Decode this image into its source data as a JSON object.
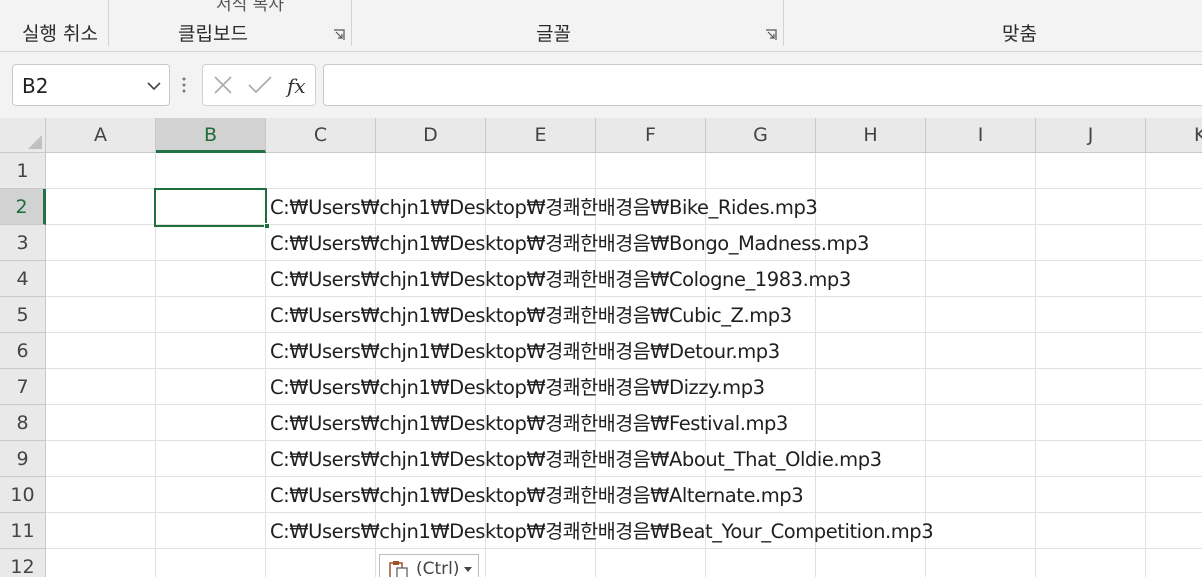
{
  "ribbon": {
    "groups": {
      "undo": "실행 취소",
      "clipboard": "클립보드",
      "font": "글꼴",
      "align": "맞춤"
    },
    "cut_off_label": "서식 복사"
  },
  "formula_bar": {
    "name_box": "B2",
    "formula_value": ""
  },
  "grid": {
    "column_headers": [
      "A",
      "B",
      "C",
      "D",
      "E",
      "F",
      "G",
      "H",
      "I",
      "J",
      "K"
    ],
    "row_headers": [
      "1",
      "2",
      "3",
      "4",
      "5",
      "6",
      "7",
      "8",
      "9",
      "10",
      "11",
      "12"
    ],
    "selected_column": "B",
    "selected_row": "2",
    "cells": [
      "C:₩Users₩chjn1₩Desktop₩경쾌한배경음₩Bike_Rides.mp3",
      "C:₩Users₩chjn1₩Desktop₩경쾌한배경음₩Bongo_Madness.mp3",
      "C:₩Users₩chjn1₩Desktop₩경쾌한배경음₩Cologne_1983.mp3",
      "C:₩Users₩chjn1₩Desktop₩경쾌한배경음₩Cubic_Z.mp3",
      "C:₩Users₩chjn1₩Desktop₩경쾌한배경음₩Detour.mp3",
      "C:₩Users₩chjn1₩Desktop₩경쾌한배경음₩Dizzy.mp3",
      "C:₩Users₩chjn1₩Desktop₩경쾌한배경음₩Festival.mp3",
      "C:₩Users₩chjn1₩Desktop₩경쾌한배경음₩About_That_Oldie.mp3",
      "C:₩Users₩chjn1₩Desktop₩경쾌한배경음₩Alternate.mp3",
      "C:₩Users₩chjn1₩Desktop₩경쾌한배경음₩Beat_Your_Competition.mp3"
    ]
  },
  "paste_options": {
    "label": "(Ctrl)"
  },
  "colors": {
    "accent": "#217346",
    "header_bg": "#e9e9e9",
    "gridline": "#e1e1e1"
  }
}
